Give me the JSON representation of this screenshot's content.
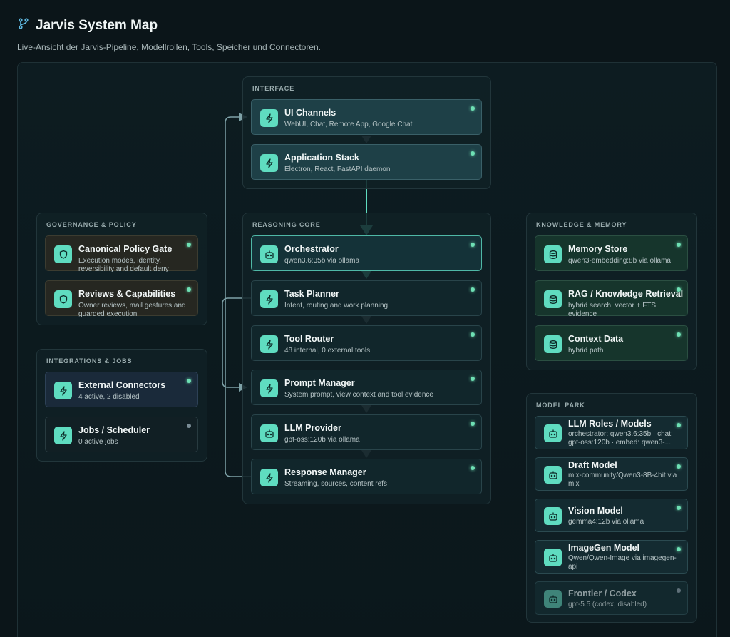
{
  "header": {
    "title": "Jarvis System Map",
    "subtitle": "Live-Ansicht der Jarvis-Pipeline, Modellrollen, Tools, Speicher und Connectoren."
  },
  "colors": {
    "accent": "#5fdcc0",
    "status_active": "#6ee0b4",
    "status_inactive": "#7a8c96",
    "background": "#0b1519"
  },
  "groups": {
    "interface": {
      "label": "INTERFACE",
      "nodes": [
        {
          "title": "UI Channels",
          "subtitle": "WebUI, Chat, Remote App, Google Chat",
          "icon": "bolt-icon",
          "status": "active"
        },
        {
          "title": "Application Stack",
          "subtitle": "Electron, React, FastAPI daemon",
          "icon": "bolt-icon",
          "status": "active"
        }
      ]
    },
    "reasoning": {
      "label": "REASONING CORE",
      "nodes": [
        {
          "title": "Orchestrator",
          "subtitle": "qwen3.6:35b via ollama",
          "icon": "robot-icon",
          "status": "active"
        },
        {
          "title": "Task Planner",
          "subtitle": "Intent, routing and work planning",
          "icon": "bolt-icon",
          "status": "active"
        },
        {
          "title": "Tool Router",
          "subtitle": "48 internal, 0 external tools",
          "icon": "bolt-icon",
          "status": "active"
        },
        {
          "title": "Prompt Manager",
          "subtitle": "System prompt, view context and tool evidence",
          "icon": "bolt-icon",
          "status": "active"
        },
        {
          "title": "LLM Provider",
          "subtitle": "gpt-oss:120b via ollama",
          "icon": "robot-icon",
          "status": "active"
        },
        {
          "title": "Response Manager",
          "subtitle": "Streaming, sources, content refs",
          "icon": "bolt-icon",
          "status": "active"
        }
      ]
    },
    "governance": {
      "label": "GOVERNANCE & POLICY",
      "nodes": [
        {
          "title": "Canonical Policy Gate",
          "subtitle": "Execution modes, identity, reversibility and default deny",
          "icon": "shield-icon",
          "status": "active"
        },
        {
          "title": "Reviews & Capabilities",
          "subtitle": "Owner reviews, mail gestures and guarded execution",
          "icon": "shield-icon",
          "status": "active"
        }
      ]
    },
    "integrations": {
      "label": "INTEGRATIONS & JOBS",
      "nodes": [
        {
          "title": "External Connectors",
          "subtitle": "4 active, 2 disabled",
          "icon": "bolt-icon",
          "status": "active"
        },
        {
          "title": "Jobs / Scheduler",
          "subtitle": "0 active jobs",
          "icon": "bolt-icon",
          "status": "inactive"
        }
      ]
    },
    "knowledge": {
      "label": "KNOWLEDGE & MEMORY",
      "nodes": [
        {
          "title": "Memory Store",
          "subtitle": "qwen3-embedding:8b via ollama",
          "icon": "database-icon",
          "status": "active"
        },
        {
          "title": "RAG / Knowledge Retrieval",
          "subtitle": "hybrid search, vector + FTS evidence",
          "icon": "database-icon",
          "status": "active"
        },
        {
          "title": "Context Data",
          "subtitle": "hybrid path",
          "icon": "database-icon",
          "status": "active"
        }
      ]
    },
    "models": {
      "label": "MODEL PARK",
      "nodes": [
        {
          "title": "LLM Roles / Models",
          "subtitle": "orchestrator: qwen3.6:35b · chat: gpt-oss:120b · embed: qwen3-...",
          "icon": "robot-icon",
          "status": "active"
        },
        {
          "title": "Draft Model",
          "subtitle": "mlx-community/Qwen3-8B-4bit via mlx",
          "icon": "robot-icon",
          "status": "active"
        },
        {
          "title": "Vision Model",
          "subtitle": "gemma4:12b via ollama",
          "icon": "robot-icon",
          "status": "active"
        },
        {
          "title": "ImageGen Model",
          "subtitle": "Qwen/Qwen-Image via imagegen-api",
          "icon": "robot-icon",
          "status": "active"
        },
        {
          "title": "Frontier / Codex",
          "subtitle": "gpt-5.5 (codex, disabled)",
          "icon": "robot-icon",
          "status": "inactive"
        }
      ]
    }
  }
}
